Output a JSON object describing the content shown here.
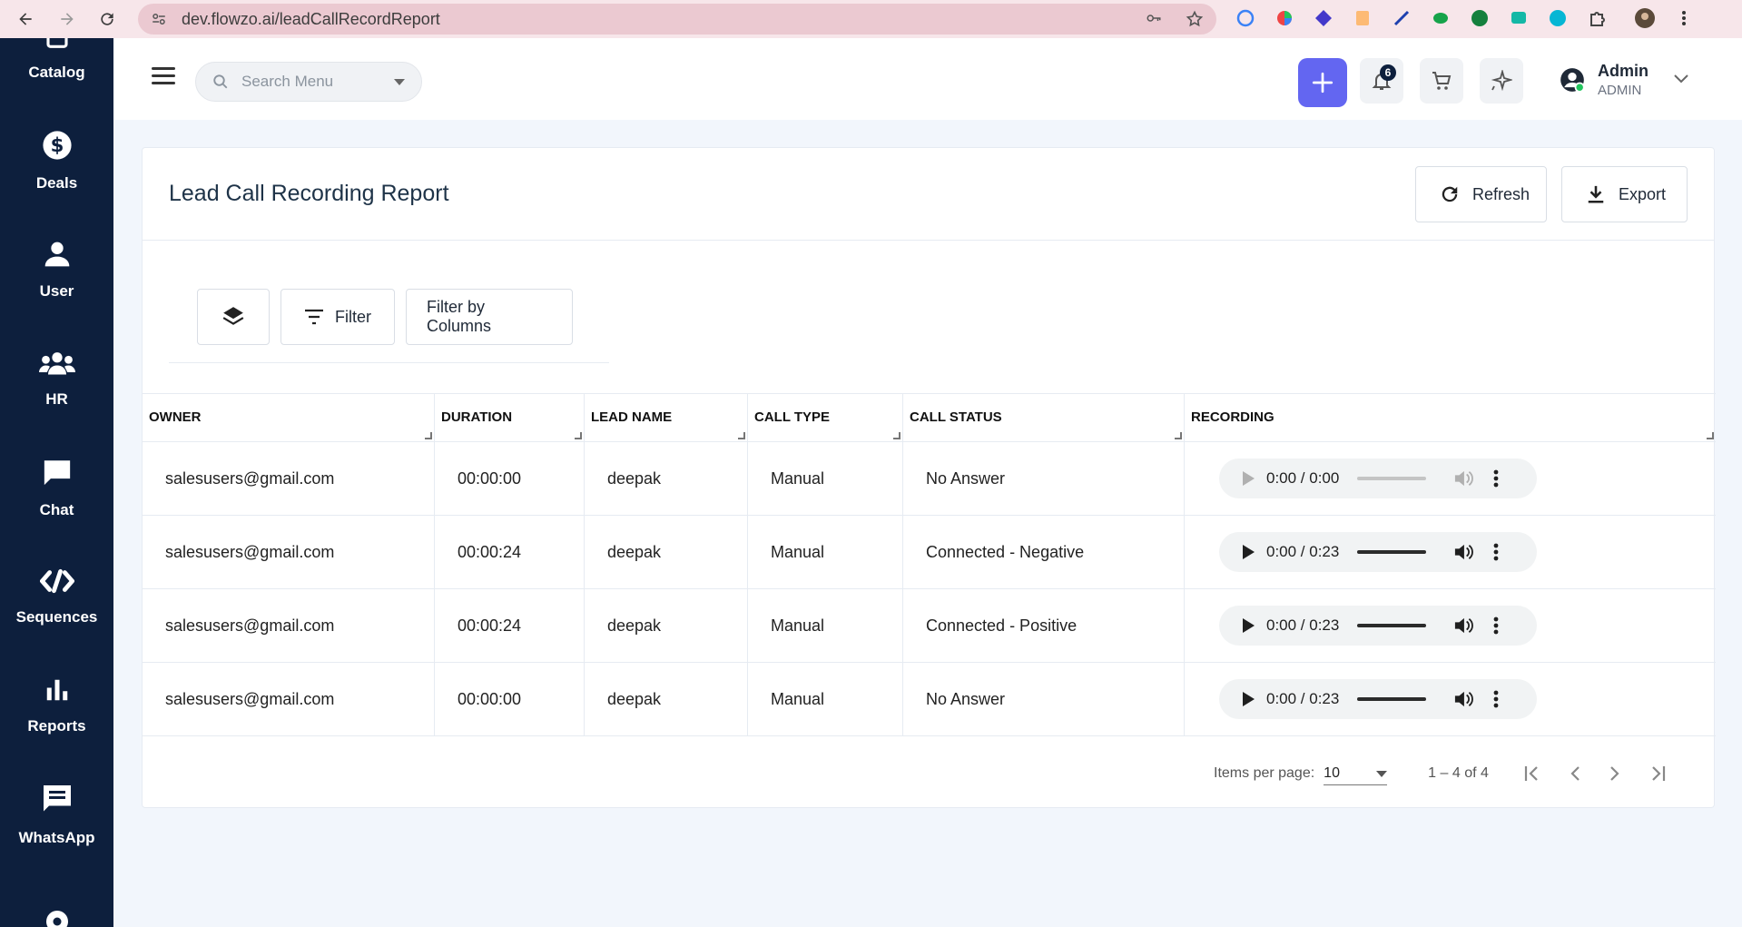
{
  "browser": {
    "url": "dev.flowzo.ai/leadCallRecordReport"
  },
  "sidebar": {
    "items": [
      {
        "label": "Catalog",
        "icon": "catalog-icon"
      },
      {
        "label": "Deals",
        "icon": "dollar-icon"
      },
      {
        "label": "User",
        "icon": "user-icon"
      },
      {
        "label": "HR",
        "icon": "group-icon"
      },
      {
        "label": "Chat",
        "icon": "chat-icon"
      },
      {
        "label": "Sequences",
        "icon": "sequences-icon"
      },
      {
        "label": "Reports",
        "icon": "bar-chart-icon"
      },
      {
        "label": "WhatsApp",
        "icon": "message-icon"
      }
    ]
  },
  "header": {
    "search_placeholder": "Search Menu",
    "notification_count": "6",
    "user_name": "Admin",
    "user_role": "ADMIN"
  },
  "page": {
    "title": "Lead Call Recording Report",
    "refresh_label": "Refresh",
    "export_label": "Export",
    "filter_label": "Filter",
    "filter_columns_label": "Filter by Columns"
  },
  "table": {
    "columns": [
      "OWNER",
      "DURATION",
      "LEAD NAME",
      "CALL TYPE",
      "CALL STATUS",
      "RECORDING"
    ],
    "rows": [
      {
        "owner": "salesusers@gmail.com",
        "duration": "00:00:00",
        "lead": "deepak",
        "type": "Manual",
        "status": "No Answer",
        "recording": "0:00 / 0:00"
      },
      {
        "owner": "salesusers@gmail.com",
        "duration": "00:00:24",
        "lead": "deepak",
        "type": "Manual",
        "status": "Connected - Negative",
        "recording": "0:00 / 0:23"
      },
      {
        "owner": "salesusers@gmail.com",
        "duration": "00:00:24",
        "lead": "deepak",
        "type": "Manual",
        "status": "Connected - Positive",
        "recording": "0:00 / 0:23"
      },
      {
        "owner": "salesusers@gmail.com",
        "duration": "00:00:00",
        "lead": "deepak",
        "type": "Manual",
        "status": "No Answer",
        "recording": "0:00 / 0:23"
      }
    ]
  },
  "pagination": {
    "items_per_page_label": "Items per page:",
    "items_per_page": "10",
    "range": "1 – 4 of 4"
  },
  "colors": {
    "sidebar_bg": "#0d1f3d",
    "accent": "#6366f1"
  }
}
